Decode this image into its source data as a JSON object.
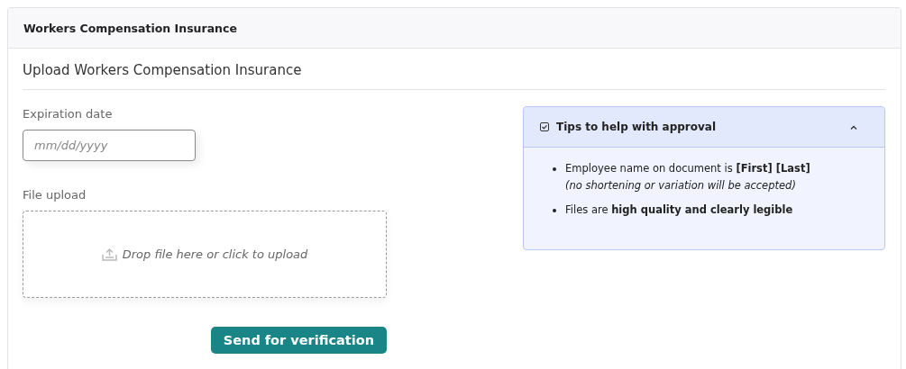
{
  "card": {
    "title": "Workers Compensation Insurance"
  },
  "section": {
    "heading": "Upload Workers Compensation Insurance"
  },
  "expiration": {
    "label": "Expiration date",
    "placeholder": "mm/dd/yyyy"
  },
  "upload": {
    "label": "File upload",
    "prompt": "Drop file here or click to upload"
  },
  "submit": {
    "label": "Send for verification"
  },
  "tips": {
    "title": "Tips to help with approval",
    "expanded": true,
    "items": [
      {
        "text": "Employee name on document is **[First] [Last]**",
        "note": "(no shortening or variation will be accepted)"
      },
      {
        "text": "Files are **high quality and clearly legible**"
      }
    ]
  }
}
